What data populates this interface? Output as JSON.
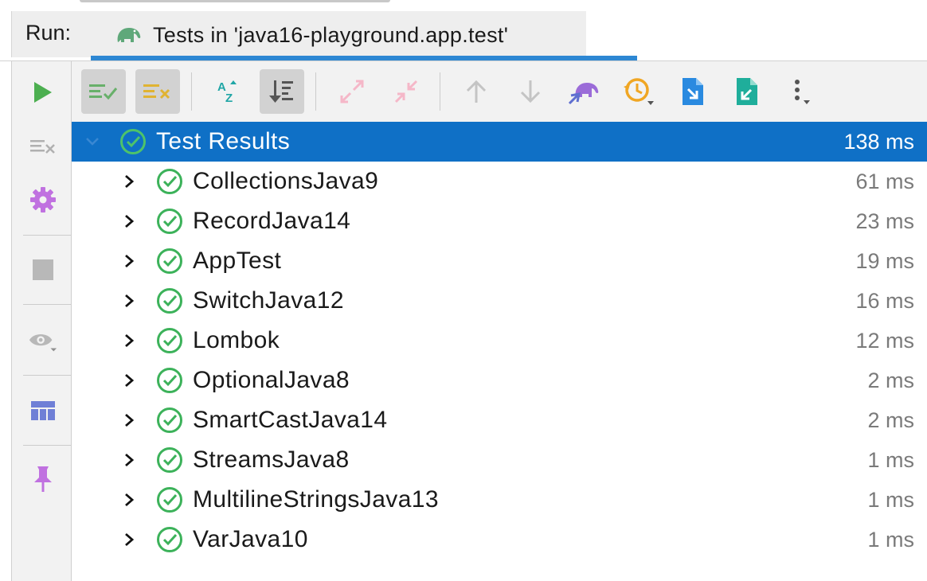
{
  "header": {
    "run_label": "Run:",
    "tab_title": "Tests in 'java16-playground.app.test'",
    "tab_icon": "gradle-elephant-icon"
  },
  "left_toolbar": [
    {
      "name": "rerun",
      "icon": "play-icon",
      "color": "#4caf50"
    },
    {
      "name": "rerun-failed",
      "icon": "rerun-failed-icon",
      "color": "#b0b0b0"
    },
    {
      "name": "settings",
      "icon": "gear-icon",
      "color": "#c071e0"
    },
    {
      "name": "stop",
      "icon": "stop-icon",
      "color": "#b8b8b8"
    },
    {
      "name": "view",
      "icon": "eye-icon",
      "color": "#b8b8b8"
    },
    {
      "name": "layout",
      "icon": "layout-icon",
      "color": "#6f7fd6"
    },
    {
      "name": "pin",
      "icon": "pin-icon",
      "color": "#c071e0"
    }
  ],
  "test_toolbar": [
    {
      "name": "show-passed",
      "icon": "show-passed-icon",
      "pressed": true
    },
    {
      "name": "show-ignored",
      "icon": "show-ignored-icon",
      "pressed": true
    },
    {
      "name": "sort-alphabetically",
      "icon": "sort-az-icon",
      "pressed": false
    },
    {
      "name": "sort-by-duration",
      "icon": "sort-duration-icon",
      "pressed": true
    },
    {
      "name": "expand-all",
      "icon": "expand-all-icon",
      "pressed": false
    },
    {
      "name": "collapse-all",
      "icon": "collapse-all-icon",
      "pressed": false
    },
    {
      "name": "previous-failed",
      "icon": "arrow-up-icon",
      "pressed": false
    },
    {
      "name": "next-failed",
      "icon": "arrow-down-icon",
      "pressed": false
    },
    {
      "name": "gradle-task",
      "icon": "gradle-icon",
      "pressed": false
    },
    {
      "name": "test-history",
      "icon": "history-icon",
      "pressed": false
    },
    {
      "name": "import-tests",
      "icon": "import-icon",
      "pressed": false
    },
    {
      "name": "export-tests",
      "icon": "export-icon",
      "pressed": false
    },
    {
      "name": "more",
      "icon": "more-vertical-icon",
      "pressed": false
    }
  ],
  "results": {
    "root": {
      "name": "Test Results",
      "time": "138 ms",
      "status": "passed"
    },
    "tests": [
      {
        "name": "CollectionsJava9",
        "time": "61 ms",
        "status": "passed"
      },
      {
        "name": "RecordJava14",
        "time": "23 ms",
        "status": "passed"
      },
      {
        "name": "AppTest",
        "time": "19 ms",
        "status": "passed"
      },
      {
        "name": "SwitchJava12",
        "time": "16 ms",
        "status": "passed"
      },
      {
        "name": "Lombok",
        "time": "12 ms",
        "status": "passed"
      },
      {
        "name": "OptionalJava8",
        "time": "2 ms",
        "status": "passed"
      },
      {
        "name": "SmartCastJava14",
        "time": "2 ms",
        "status": "passed"
      },
      {
        "name": "StreamsJava8",
        "time": "1 ms",
        "status": "passed"
      },
      {
        "name": "MultilineStringsJava13",
        "time": "1 ms",
        "status": "passed"
      },
      {
        "name": "VarJava10",
        "time": "1 ms",
        "status": "passed"
      }
    ]
  },
  "colors": {
    "selection": "#0f70c6",
    "tab_underline": "#2d87d3",
    "passed": "#3cb25a"
  }
}
